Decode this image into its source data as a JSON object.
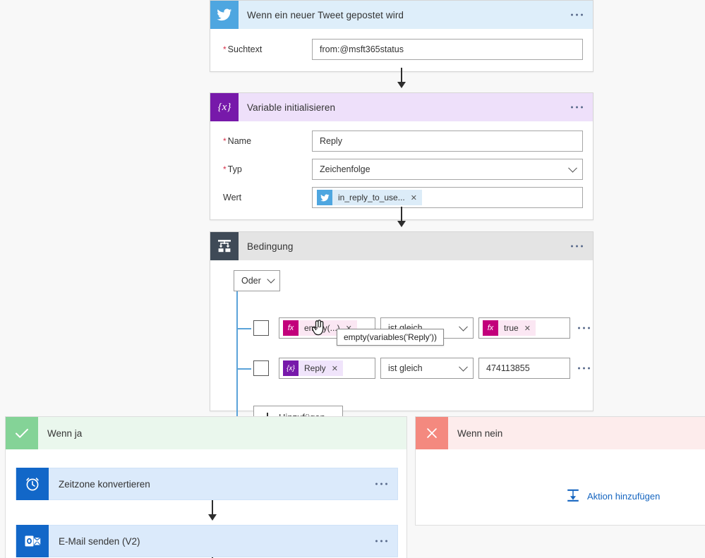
{
  "flow": {
    "trigger": {
      "title": "Wenn ein neuer Tweet gepostet wird",
      "icon": "twitter-icon",
      "fields": [
        {
          "label": "Suchtext",
          "required": true,
          "value": "from:@msft365status"
        }
      ]
    },
    "variable_action": {
      "title": "Variable initialisieren",
      "icon": "variable-icon",
      "fields": [
        {
          "label": "Name",
          "required": true,
          "value": "Reply"
        },
        {
          "label": "Typ",
          "required": true,
          "value": "Zeichenfolge",
          "control": "select"
        },
        {
          "label": "Wert",
          "required": false,
          "token": "in_reply_to_use...",
          "token_icon": "twitter-icon"
        }
      ]
    },
    "condition": {
      "title": "Bedingung",
      "icon": "condition-icon",
      "operator": "Oder",
      "add_button": "Hinzufügen",
      "rows": [
        {
          "left_token": "empty(...)",
          "left_icon": "fx-icon",
          "operator": "ist gleich",
          "right_token": "true",
          "right_icon": "fx-icon",
          "right_type": "token"
        },
        {
          "left_token": "Reply",
          "left_icon": "variable-icon",
          "operator": "ist gleich",
          "right_value": "474113855",
          "right_type": "text"
        }
      ],
      "tooltip": "empty(variables('Reply'))"
    },
    "branch_yes": {
      "title": "Wenn ja",
      "icon": "check-icon",
      "actions": [
        {
          "title": "Zeitzone konvertieren",
          "icon": "clock-icon"
        },
        {
          "title": "E-Mail senden (V2)",
          "icon": "outlook-icon"
        }
      ]
    },
    "branch_no": {
      "title": "Wenn nein",
      "icon": "close-icon",
      "add_action_label": "Aktion hinzufügen",
      "add_action_icon": "add-action-icon",
      "actions": []
    }
  },
  "colors": {
    "twitter": "#4ea6e0",
    "variable": "#7719aa",
    "condition": "#3f4a57",
    "fx": "#c2007b",
    "yes": "#84d397",
    "no": "#f4897f",
    "action": "#1267c8",
    "link": "#1565c0"
  }
}
